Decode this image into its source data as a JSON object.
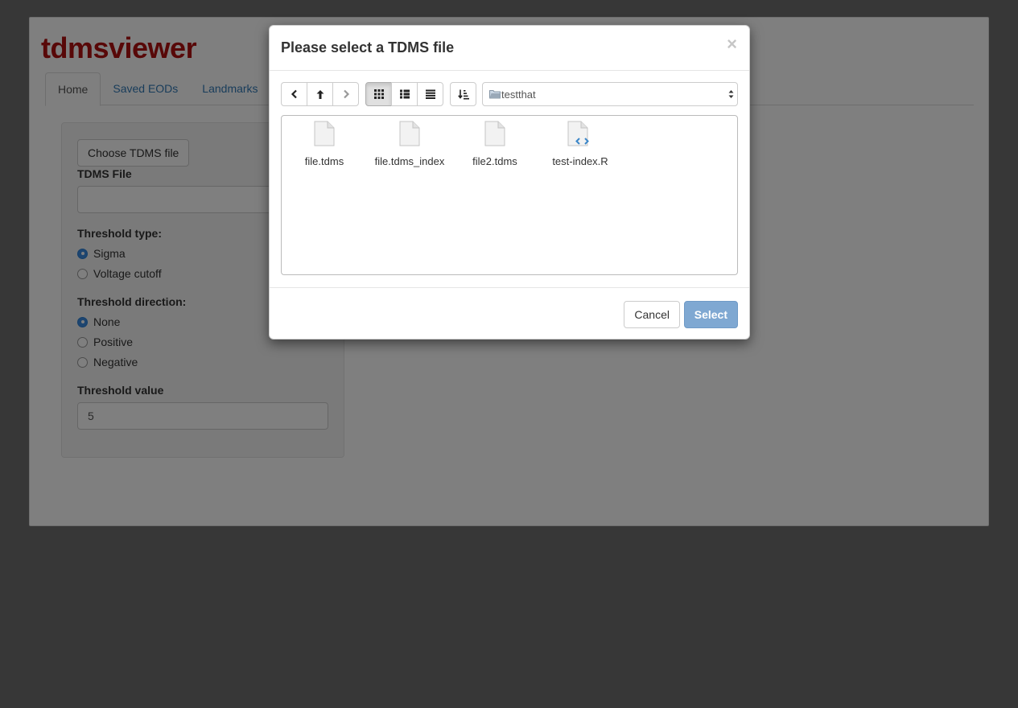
{
  "app": {
    "title": "tdmsviewer",
    "tabs": [
      {
        "label": "Home",
        "active": true
      },
      {
        "label": "Saved EODs",
        "active": false
      },
      {
        "label": "Landmarks",
        "active": false
      }
    ]
  },
  "sidebar": {
    "choose_button": "Choose TDMS file",
    "tdms_file_label": "TDMS File",
    "tdms_file_value": "",
    "threshold_type_label": "Threshold type:",
    "threshold_type_options": [
      {
        "label": "Sigma",
        "selected": true
      },
      {
        "label": "Voltage cutoff",
        "selected": false
      }
    ],
    "threshold_direction_label": "Threshold direction:",
    "threshold_direction_options": [
      {
        "label": "None",
        "selected": true
      },
      {
        "label": "Positive",
        "selected": false
      },
      {
        "label": "Negative",
        "selected": false
      }
    ],
    "threshold_value_label": "Threshold value",
    "threshold_value": "5"
  },
  "modal": {
    "title": "Please select a TDMS file",
    "close_glyph": "×",
    "current_directory": "testthat",
    "view_mode": "icons",
    "files": [
      {
        "name": "file.tdms",
        "icon": "file-icon"
      },
      {
        "name": "file.tdms_index",
        "icon": "file-icon"
      },
      {
        "name": "file2.tdms",
        "icon": "file-icon"
      },
      {
        "name": "test-index.R",
        "icon": "code-file-icon"
      }
    ],
    "cancel_label": "Cancel",
    "select_label": "Select"
  },
  "colors": {
    "brand_title": "#b01010",
    "link": "#337ab7",
    "primary_disabled": "#7fa8d2"
  }
}
